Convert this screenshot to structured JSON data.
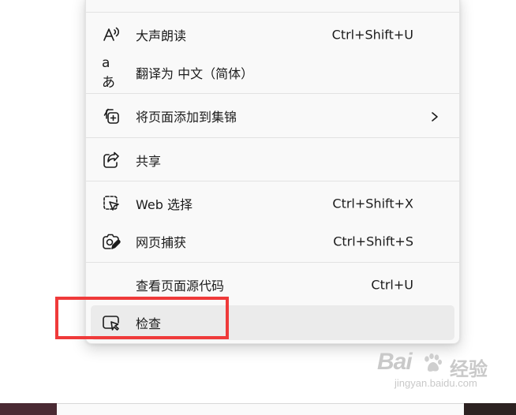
{
  "menu": {
    "items": [
      {
        "label": "大声朗读",
        "shortcut": "Ctrl+Shift+U",
        "icon": "read-aloud-icon"
      },
      {
        "label": "翻译为 中文（简体）",
        "shortcut": "",
        "icon": "translate-icon",
        "icon_text": "aあ"
      },
      {
        "label": "将页面添加到集锦",
        "shortcut": "",
        "icon": "collections-add-icon",
        "submenu": true
      },
      {
        "label": "共享",
        "shortcut": "",
        "icon": "share-icon"
      },
      {
        "label": "Web 选择",
        "shortcut": "Ctrl+Shift+X",
        "icon": "web-select-icon"
      },
      {
        "label": "网页捕获",
        "shortcut": "Ctrl+Shift+S",
        "icon": "web-capture-icon"
      },
      {
        "label": "查看页面源代码",
        "shortcut": "Ctrl+U",
        "icon": ""
      },
      {
        "label": "检查",
        "shortcut": "",
        "icon": "inspect-icon",
        "hovered": true
      }
    ]
  },
  "highlight_color": "#ef3a3a",
  "watermark": {
    "logo": "Bai",
    "name": "经验",
    "url": "jingyan.baidu.com"
  }
}
